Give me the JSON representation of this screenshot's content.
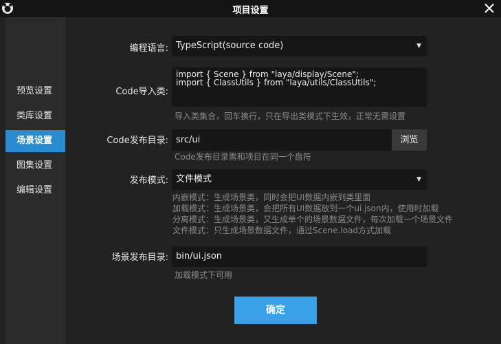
{
  "window": {
    "title": "项目设置"
  },
  "sidebar": {
    "items": [
      {
        "label": "预览设置",
        "active": false
      },
      {
        "label": "类库设置",
        "active": false
      },
      {
        "label": "场景设置",
        "active": true
      },
      {
        "label": "图集设置",
        "active": false
      },
      {
        "label": "编辑设置",
        "active": false
      }
    ]
  },
  "form": {
    "language": {
      "label": "编程语言:",
      "value": "TypeScript(source code)"
    },
    "code_import": {
      "label": "Code导入类:",
      "line1": "import { Scene } from \"laya/display/Scene\";",
      "line2": "import { ClassUtils } from \"laya/utils/ClassUtils\";",
      "hint": "导入类集合，回车换行，只在导出类模式下生效，正常无需设置"
    },
    "code_output": {
      "label": "Code发布目录:",
      "value": "src/ui",
      "browse_label": "浏览",
      "hint": "Code发布目录需和项目在同一个盘符"
    },
    "publish_mode": {
      "label": "发布模式:",
      "value": "文件模式",
      "hints": [
        "内嵌模式：生成场景类，同时会把UI数据内嵌到类里面",
        "加载模式：生成场景类，会把所有UI数据放到一个ui.json内，使用时加载",
        "分离模式：生成场景类，又生成单个的场景数据文件，每次加载一个场景文件",
        "文件模式：只生成场景数据文件，通过Scene.load方式加载"
      ]
    },
    "scene_output": {
      "label": "场景发布目录:",
      "value": "bin/ui.json",
      "hint": "加载模式下可用"
    }
  },
  "footer": {
    "confirm_label": "确定"
  },
  "colors": {
    "accent": "#2a8ccf",
    "button": "#3aa0e8",
    "bg": "#222222",
    "field": "#161616"
  }
}
